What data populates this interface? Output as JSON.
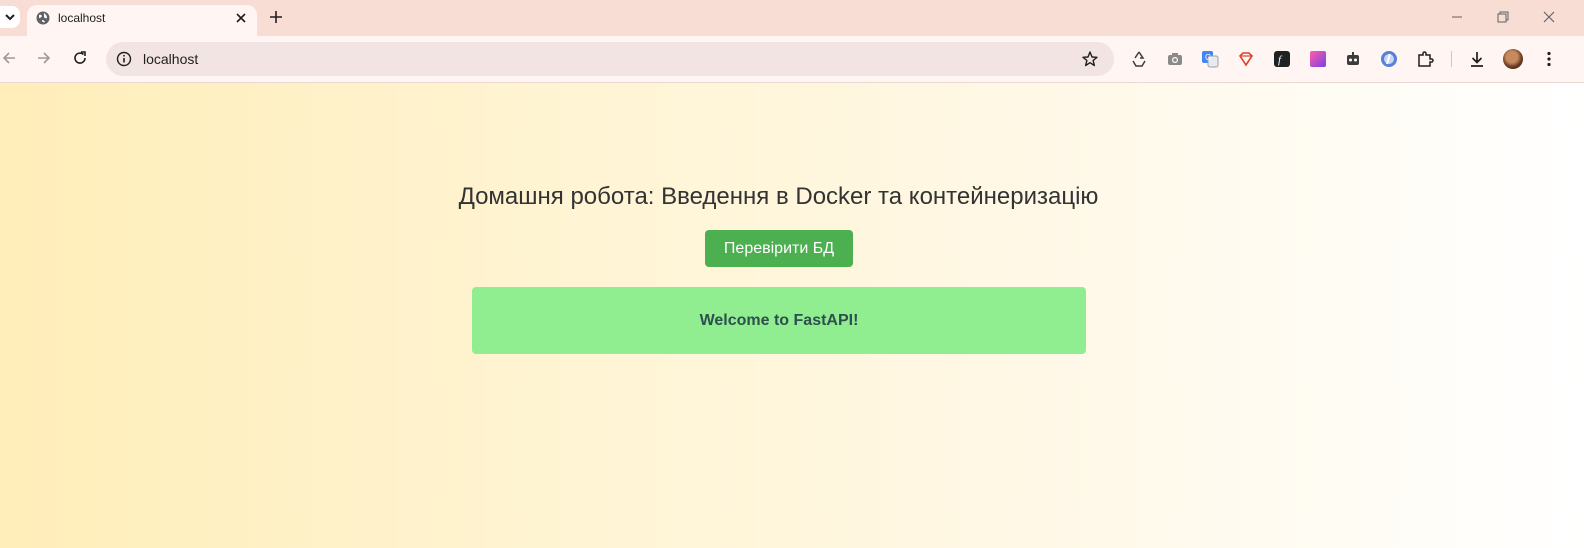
{
  "browser": {
    "tab": {
      "title": "localhost",
      "favicon": "globe-icon"
    },
    "address_bar": {
      "url": "localhost"
    },
    "extensions": [
      "recycle-icon",
      "camera-icon",
      "translate-icon",
      "gem-icon",
      "font-f-icon",
      "gradient-square-icon",
      "robot-icon",
      "disc-icon",
      "puzzle-icon",
      "download-icon",
      "avatar",
      "more-vert-icon"
    ]
  },
  "page": {
    "heading": "Домашня робота: Введення в Docker та контейнеризацію",
    "check_button_label": "Перевірити БД",
    "message": "Welcome to FastAPI!"
  },
  "colors": {
    "button_bg": "#4caf50",
    "message_bg": "#90ee90",
    "message_text": "#2f4f4f",
    "gradient_left": "#ffeeb9",
    "gradient_right": "#ffffff"
  }
}
